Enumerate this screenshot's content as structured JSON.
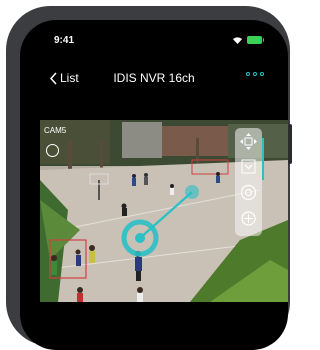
{
  "status_bar": {
    "time": "9:41"
  },
  "nav": {
    "back_label": "List",
    "title": "IDIS NVR 16ch"
  },
  "video": {
    "camera_label": "CAM5"
  },
  "colors": {
    "accent": "#29c0c6",
    "battery": "#3ccf55"
  }
}
